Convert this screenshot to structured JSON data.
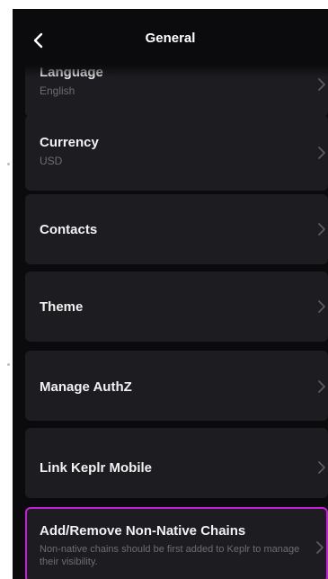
{
  "header": {
    "title": "General",
    "back_icon": "chevron-left-icon"
  },
  "items": [
    {
      "label": "Language",
      "value": "English"
    },
    {
      "label": "Currency",
      "value": "USD"
    },
    {
      "label": "Contacts"
    },
    {
      "label": "Theme"
    },
    {
      "label": "Manage AuthZ"
    },
    {
      "label": "Link Keplr Mobile"
    },
    {
      "label": "Add/Remove Non-Native Chains",
      "description": "Non-native chains should be first added to Keplr to manage their visibility."
    }
  ],
  "colors": {
    "background": "#0b0b0d",
    "card": "#1c1c21",
    "highlight_border": "#c51ed8",
    "text": "#f2f2f2",
    "subtext": "#6d6d75"
  },
  "icons": {
    "row_chevron": "chevron-right-icon"
  }
}
